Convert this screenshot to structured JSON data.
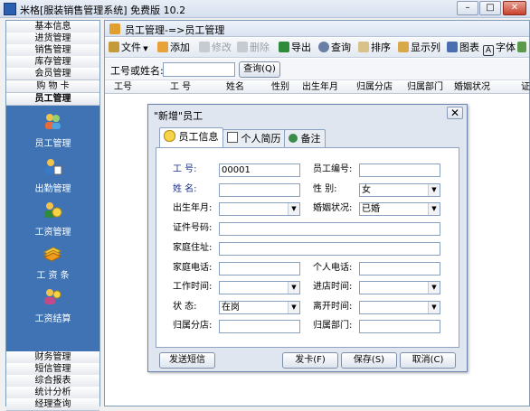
{
  "window": {
    "title": "米格[服装销售管理系统] 免费版 10.2",
    "minimize": "–",
    "maximize": "□",
    "close": "✕"
  },
  "nav": {
    "top_items": [
      "基本信息",
      "进货管理",
      "销售管理",
      "库存管理",
      "会员管理",
      "购 物 卡",
      "员工管理"
    ],
    "panel_items": [
      "员工管理",
      "出勤管理",
      "工资管理",
      "工 资 条",
      "工资结算"
    ],
    "bottom_items": [
      "财务管理",
      "短信管理",
      "综合报表",
      "统计分析",
      "经理查询"
    ]
  },
  "main": {
    "header": "员工管理-=>员工管理",
    "toolbar": {
      "file": "文件",
      "add": "添加",
      "edit": "修改",
      "delete": "删除",
      "export": "导出",
      "query": "查询",
      "sort": "排序",
      "columns": "显示列",
      "chart": "图表",
      "font": "字体"
    },
    "search": {
      "label": "工号或姓名:",
      "value": "",
      "button": "查询(Q)"
    },
    "columns": [
      "工号",
      "工 号",
      "姓名",
      "性别",
      "出生年月",
      "归属分店",
      "归属部门",
      "婚姻状况",
      "证"
    ]
  },
  "dialog": {
    "title": "\"新增\"员工",
    "close": "✕",
    "tabs": [
      "员工信息",
      "个人简历",
      "备注"
    ],
    "fields": {
      "emp_id": {
        "label": "工    号:",
        "value": "00001"
      },
      "emp_code": {
        "label": "员工编号:",
        "value": ""
      },
      "name": {
        "label": "姓    名:",
        "value": ""
      },
      "gender": {
        "label": "性    别:",
        "value": "女"
      },
      "birth": {
        "label": "出生年月:",
        "value": ""
      },
      "marital": {
        "label": "婚姻状况:",
        "value": "已婚"
      },
      "id_no": {
        "label": "证件号码:",
        "value": ""
      },
      "address": {
        "label": "家庭住址:",
        "value": ""
      },
      "home_phone": {
        "label": "家庭电话:",
        "value": ""
      },
      "mobile": {
        "label": "个人电话:",
        "value": ""
      },
      "work_time": {
        "label": "工作时间:",
        "value": ""
      },
      "join_time": {
        "label": "进店时间:",
        "value": ""
      },
      "status": {
        "label": "状    态:",
        "value": "在岗"
      },
      "leave_time": {
        "label": "离开时间:",
        "value": ""
      },
      "branch": {
        "label": "归属分店:",
        "value": ""
      },
      "dept": {
        "label": "归属部门:",
        "value": ""
      }
    },
    "buttons": {
      "sms": "发送短信",
      "card": "发卡(F)",
      "save": "保存(S)",
      "cancel": "取消(C)"
    }
  },
  "colors": {
    "nav_panel": "#3f73b4",
    "label_blue": "#1a2f8a",
    "border": "#7f9db9"
  }
}
